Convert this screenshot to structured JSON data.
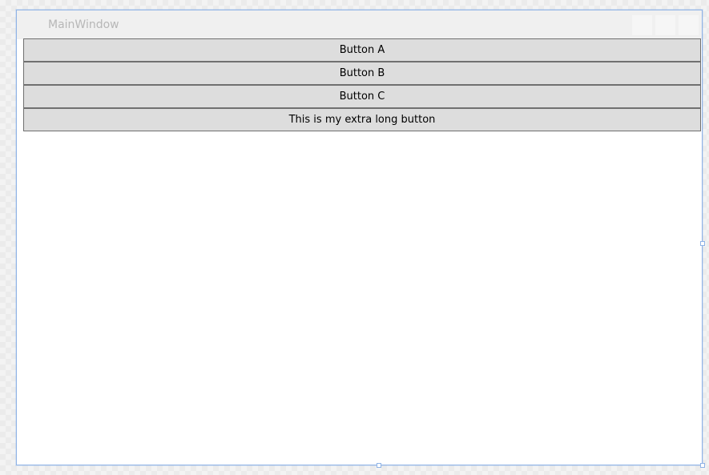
{
  "window": {
    "title": "MainWindow"
  },
  "buttons": [
    {
      "label": "Button A"
    },
    {
      "label": "Button B"
    },
    {
      "label": "Button C"
    },
    {
      "label": "This is my extra long button"
    }
  ],
  "colors": {
    "button_background": "#dddddd",
    "button_border": "#707070",
    "window_border": "#8fb3e6",
    "title_text": "#b7b7b7"
  }
}
